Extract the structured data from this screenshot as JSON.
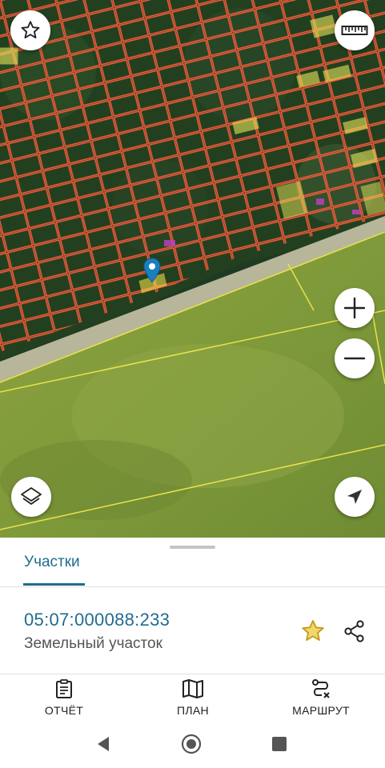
{
  "map": {
    "colors": {
      "parcel_outline": "#ff5a3c",
      "selected_parcel": "#ffe94d",
      "boundary": "#e8e34a",
      "pin": "#1a7fc0"
    },
    "icons": {
      "favorite": "star-outline-icon",
      "ruler": "ruler-icon",
      "zoom_in": "plus-icon",
      "zoom_out": "minus-icon",
      "layers": "layers-icon",
      "locate": "navigation-arrow-icon"
    }
  },
  "sheet": {
    "tab_label": "Участки",
    "cadastral_number": "05:07:000088:233",
    "parcel_type": "Земельный участок",
    "accent_color": "#1f6c8f",
    "favorite_color": "#d4a514"
  },
  "bottom_nav": [
    {
      "label": "ОТЧЁТ",
      "icon": "clipboard-icon"
    },
    {
      "label": "ПЛАН",
      "icon": "map-icon"
    },
    {
      "label": "МАРШРУТ",
      "icon": "route-icon"
    }
  ],
  "system_nav": {
    "icons": [
      "back-triangle-icon",
      "home-circle-icon",
      "recents-square-icon"
    ]
  }
}
